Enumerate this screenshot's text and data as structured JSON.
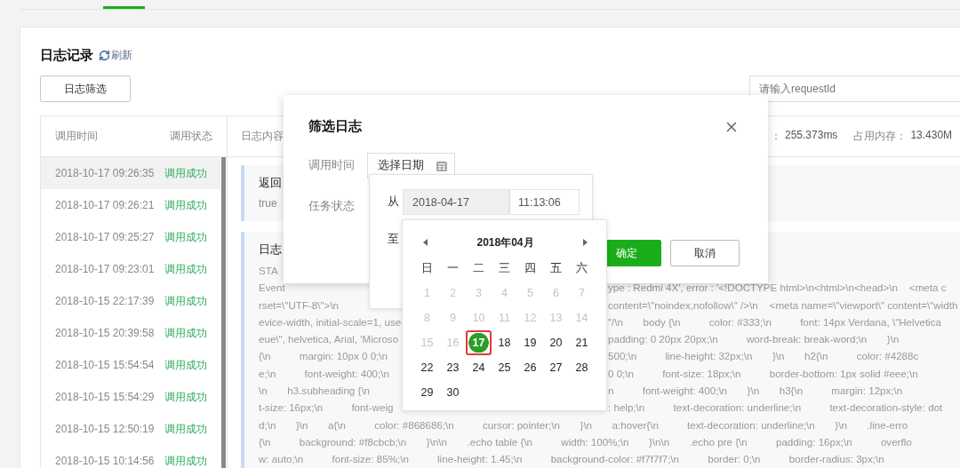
{
  "header": {
    "title": "日志记录",
    "refresh": "刷新"
  },
  "toolbar": {
    "filter_button": "日志筛选",
    "search": {
      "placeholder": "请输入requestId"
    }
  },
  "list": {
    "columns": [
      "调用时间",
      "调用状态"
    ],
    "rows": [
      {
        "time": "2018-10-17 09:26:35",
        "status": "调用成功",
        "selected": true
      },
      {
        "time": "2018-10-17 09:26:21",
        "status": "调用成功",
        "selected": false
      },
      {
        "time": "2018-10-17 09:25:27",
        "status": "调用成功",
        "selected": false
      },
      {
        "time": "2018-10-17 09:23:01",
        "status": "调用成功",
        "selected": false
      },
      {
        "time": "2018-10-15 22:17:39",
        "status": "调用成功",
        "selected": false
      },
      {
        "time": "2018-10-15 20:39:58",
        "status": "调用成功",
        "selected": false
      },
      {
        "time": "2018-10-15 15:54:54",
        "status": "调用成功",
        "selected": false
      },
      {
        "time": "2018-10-15 15:54:29",
        "status": "调用成功",
        "selected": false
      },
      {
        "time": "2018-10-15 12:50:19",
        "status": "调用成功",
        "selected": false
      },
      {
        "time": "2018-10-15 10:14:56",
        "status": "调用成功",
        "selected": false
      }
    ]
  },
  "detail": {
    "heading": "日志内容",
    "stats": [
      "：",
      "255.373ms",
      "占用内存：",
      "13.430M"
    ],
    "result": {
      "label": "返回",
      "value": "true"
    },
    "log": {
      "label": "日志",
      "lines": [
        {
          "kind": "full",
          "text": "STA"
        },
        {
          "kind": "split",
          "left": "Event",
          "right": "ype : Redmi 4X', error : '<!DOCTYPE html>\\n<html>\\n<head>\\n    <meta c"
        },
        {
          "kind": "split",
          "left": "rset=\\\"UTF-8\\\">\\n",
          "right": "content=\\\"noindex,nofollow\\\" />\\n    <meta name=\\\"viewport\\\" content=\\\"width"
        },
        {
          "kind": "split",
          "left": "evice-width, initial-scale=1, use",
          "right": "\"/\\n       body {\\n          color: #333;\\n          font: 14px Verdana, \\\"Helvetica"
        },
        {
          "kind": "split",
          "left": "eue\\\", helvetica, Arial, 'Microso",
          "right": "padding: 0 20px 20px;\\n          word-break: break-word;\\n       }\\n"
        },
        {
          "kind": "split",
          "left": "{\\n          margin: 10px 0 0;\\n",
          "right": "500;\\n          line-height: 32px;\\n       }\\n       h2{\\n          color: #4288c"
        },
        {
          "kind": "split",
          "left": "e;\\n          font-weight: 400;\\n",
          "right": "0 0;\\n          font-size: 18px;\\n          border-bottom: 1px solid #eee;\\n"
        },
        {
          "kind": "split",
          "left": "\\n       h3.subheading {\\n",
          "right": "n          font-weight: 400;\\n       }\\n       h3{\\n          margin: 12px;\\n"
        },
        {
          "kind": "split",
          "left": "t-size: 16px;\\n          font-weig",
          "right": ": help;\\n          text-decoration: underline;\\n          text-decoration-style: dot"
        },
        {
          "kind": "full",
          "text": "d;\\n       }\\n       a{\\n          color: #868686;\\n          cursor: pointer;\\n       }\\n       a:hover{\\n          text-decoration: underline;\\n       }\\n       .line-erro"
        },
        {
          "kind": "full",
          "text": "{\\n          background: #f8cbcb;\\n       }\\n\\n       .echo table {\\n          width: 100%;\\n       }\\n\\n       .echo pre {\\n          padding: 16px;\\n          overflo"
        },
        {
          "kind": "full",
          "text": "w: auto;\\n          font-size: 85%;\\n          line-height: 1.45;\\n          background-color: #f7f7f7;\\n          border: 0;\\n          border-radius: 3px;\\n"
        }
      ]
    }
  },
  "modal": {
    "title": "筛选日志",
    "fields": [
      "调用时间",
      "任务状态"
    ],
    "date_button": "选择日期",
    "buttons": [
      {
        "label": "确定",
        "kind": "primary"
      },
      {
        "label": "取消",
        "kind": "default"
      }
    ]
  },
  "range": {
    "from_label": "从",
    "from_date": "2018-04-17",
    "from_time": "11:13:06",
    "to_label": "至"
  },
  "calendar": {
    "title": "2018年04月",
    "weekdays": [
      "日",
      "一",
      "二",
      "三",
      "四",
      "五",
      "六"
    ],
    "days": [
      {
        "label": "1",
        "disabled": true,
        "selected": false
      },
      {
        "label": "2",
        "disabled": true,
        "selected": false
      },
      {
        "label": "3",
        "disabled": true,
        "selected": false
      },
      {
        "label": "4",
        "disabled": true,
        "selected": false
      },
      {
        "label": "5",
        "disabled": true,
        "selected": false
      },
      {
        "label": "6",
        "disabled": true,
        "selected": false
      },
      {
        "label": "7",
        "disabled": true,
        "selected": false
      },
      {
        "label": "8",
        "disabled": true,
        "selected": false
      },
      {
        "label": "9",
        "disabled": true,
        "selected": false
      },
      {
        "label": "10",
        "disabled": true,
        "selected": false
      },
      {
        "label": "11",
        "disabled": true,
        "selected": false
      },
      {
        "label": "12",
        "disabled": true,
        "selected": false
      },
      {
        "label": "13",
        "disabled": true,
        "selected": false
      },
      {
        "label": "14",
        "disabled": true,
        "selected": false
      },
      {
        "label": "15",
        "disabled": true,
        "selected": false
      },
      {
        "label": "16",
        "disabled": true,
        "selected": false
      },
      {
        "label": "17",
        "disabled": false,
        "selected": true
      },
      {
        "label": "18",
        "disabled": false,
        "selected": false
      },
      {
        "label": "19",
        "disabled": false,
        "selected": false
      },
      {
        "label": "20",
        "disabled": false,
        "selected": false
      },
      {
        "label": "21",
        "disabled": false,
        "selected": false
      },
      {
        "label": "22",
        "disabled": false,
        "selected": false
      },
      {
        "label": "23",
        "disabled": false,
        "selected": false
      },
      {
        "label": "24",
        "disabled": false,
        "selected": false
      },
      {
        "label": "25",
        "disabled": false,
        "selected": false
      },
      {
        "label": "26",
        "disabled": false,
        "selected": false
      },
      {
        "label": "27",
        "disabled": false,
        "selected": false
      },
      {
        "label": "28",
        "disabled": false,
        "selected": false
      },
      {
        "label": "29",
        "disabled": false,
        "selected": false
      },
      {
        "label": "30",
        "disabled": false,
        "selected": false
      }
    ]
  }
}
